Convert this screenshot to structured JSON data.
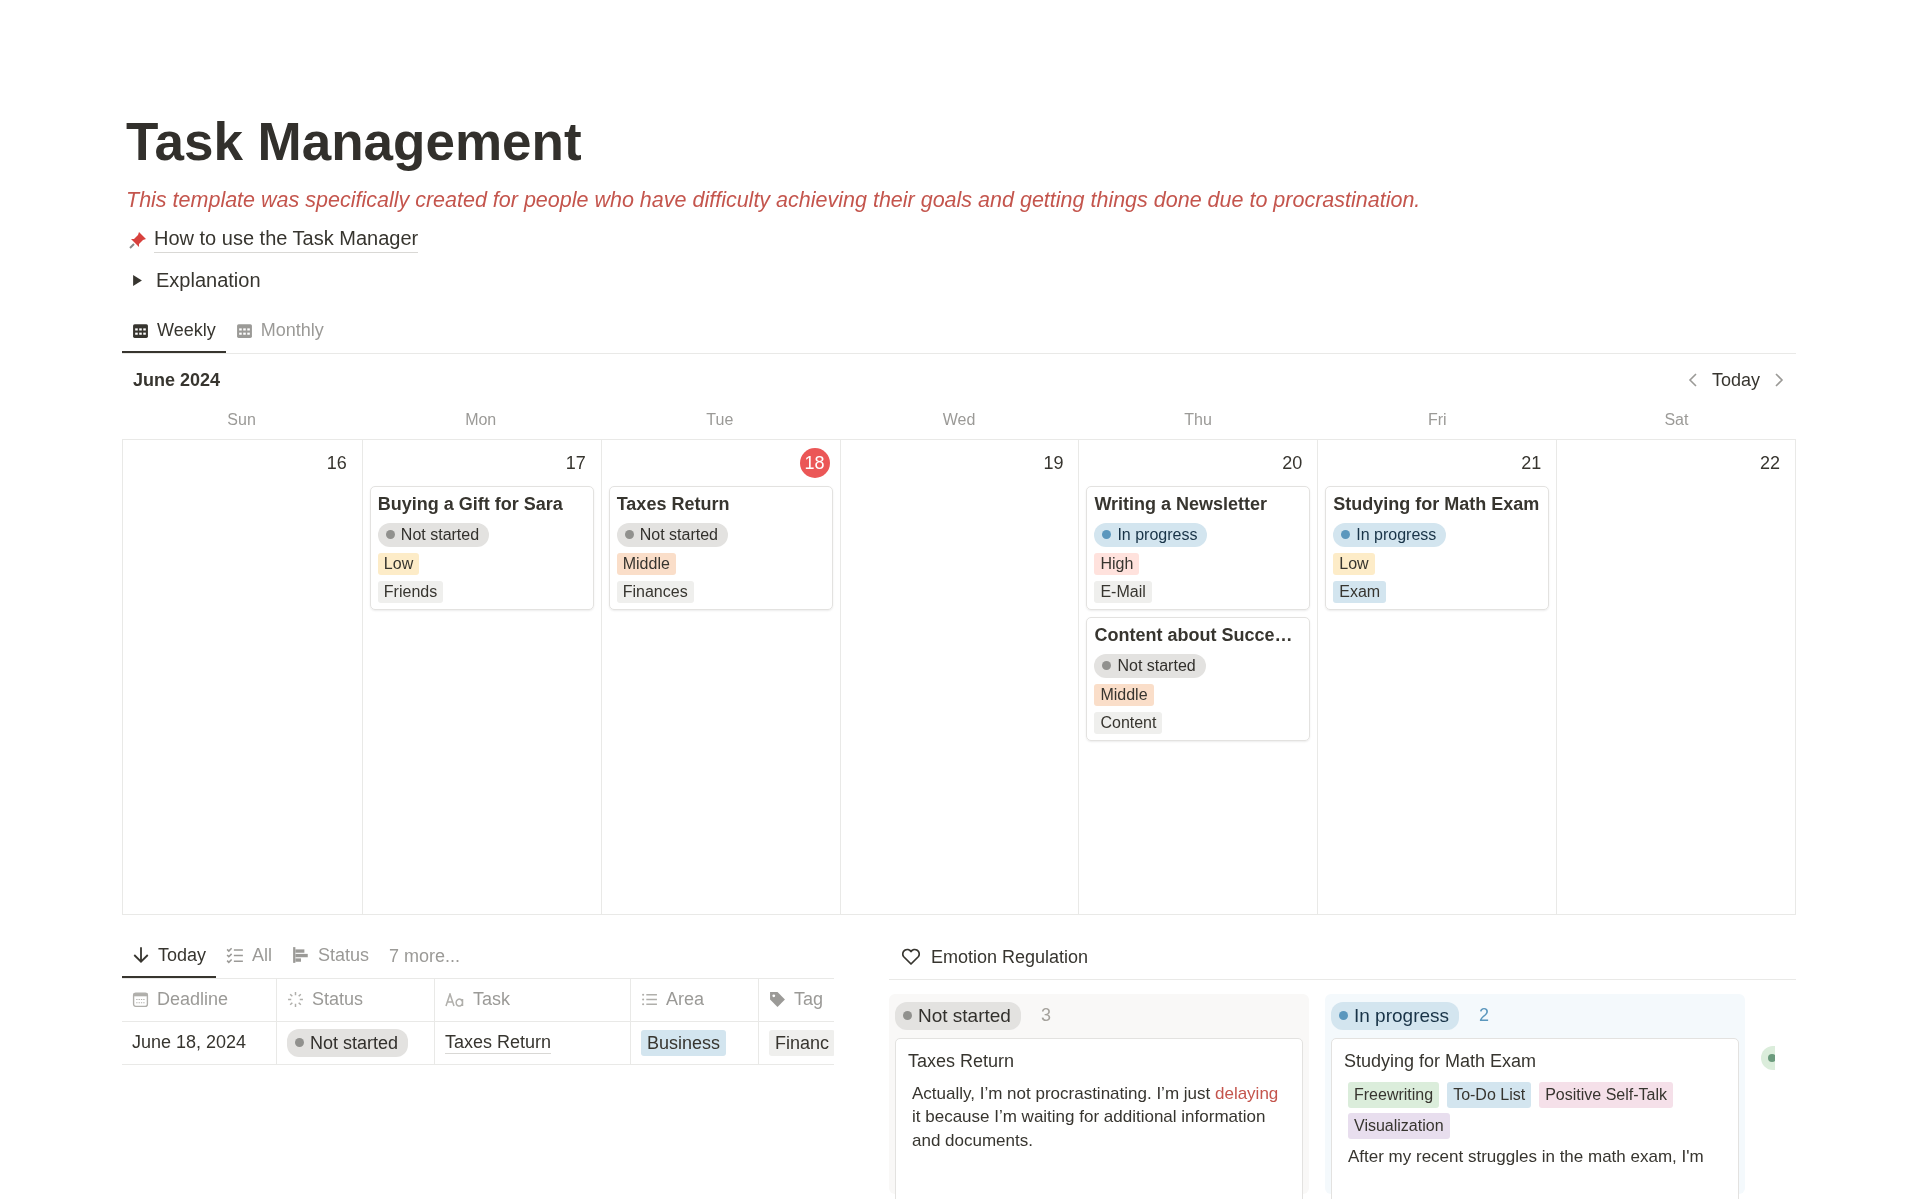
{
  "page": {
    "title": "Task Management",
    "description": "This template was specifically created for people who have difficulty achieving their goals and getting things done due to procrastination.",
    "link": {
      "label": "How to use the Task Manager"
    },
    "toggle": {
      "label": "Explanation",
      "expanded": false
    }
  },
  "calendar_tabs": [
    {
      "label": "Weekly",
      "selected": true
    },
    {
      "label": "Monthly",
      "selected": false
    }
  ],
  "calendar": {
    "month": "June 2024",
    "today_button": "Today",
    "weekdays": [
      "Sun",
      "Mon",
      "Tue",
      "Wed",
      "Thu",
      "Fri",
      "Sat"
    ],
    "days": [
      {
        "date": "16",
        "today": false
      },
      {
        "date": "17",
        "today": false,
        "events": [
          {
            "title": "Buying a Gift for Sara",
            "status": {
              "label": "Not started",
              "kind": "not_started"
            },
            "priority": {
              "label": "Low",
              "color": "#fdecc8"
            },
            "area": {
              "label": "Friends",
              "color": "#efefed"
            }
          }
        ]
      },
      {
        "date": "18",
        "today": true,
        "events": [
          {
            "title": "Taxes Return",
            "status": {
              "label": "Not started",
              "kind": "not_started"
            },
            "priority": {
              "label": "Middle",
              "color": "#fadec9"
            },
            "area": {
              "label": "Finances",
              "color": "#efefed"
            }
          }
        ]
      },
      {
        "date": "19",
        "today": false
      },
      {
        "date": "20",
        "today": false,
        "events": [
          {
            "title": "Writing a Newsletter",
            "status": {
              "label": "In progress",
              "kind": "in_progress"
            },
            "priority": {
              "label": "High",
              "color": "#ffe2dd"
            },
            "area": {
              "label": "E-Mail",
              "color": "#efefed"
            }
          },
          {
            "title": "Content about Succe…",
            "status": {
              "label": "Not started",
              "kind": "not_started"
            },
            "priority": {
              "label": "Middle",
              "color": "#fadec9"
            },
            "area": {
              "label": "Content",
              "color": "#efefed"
            }
          }
        ]
      },
      {
        "date": "21",
        "today": false,
        "events": [
          {
            "title": "Studying for Math Exam",
            "status": {
              "label": "In progress",
              "kind": "in_progress"
            },
            "priority": {
              "label": "Low",
              "color": "#fdecc8"
            },
            "area": {
              "label": "Exam",
              "color": "#d3e5ef"
            }
          }
        ]
      },
      {
        "date": "22",
        "today": false
      }
    ]
  },
  "table_view": {
    "tabs": [
      {
        "label": "Today",
        "kind": "sort",
        "selected": true
      },
      {
        "label": "All",
        "kind": "checklist",
        "selected": false
      },
      {
        "label": "Status",
        "kind": "board",
        "selected": false
      }
    ],
    "more_button": "7 more...",
    "columns": [
      {
        "label": "Deadline",
        "kind": "date"
      },
      {
        "label": "Status",
        "kind": "status"
      },
      {
        "label": "Task",
        "kind": "title"
      },
      {
        "label": "Area",
        "kind": "select"
      },
      {
        "label": "Tag",
        "kind": "tags"
      }
    ],
    "rows": [
      {
        "deadline": "June 18, 2024",
        "status": {
          "label": "Not started",
          "kind": "not_started"
        },
        "task": "Taxes Return",
        "area": {
          "label": "Business",
          "color": "#d3e5ef"
        },
        "tags": {
          "label": "Financ",
          "color": "#efefed"
        }
      }
    ]
  },
  "board": {
    "title": "Emotion Regulation",
    "groups": [
      {
        "label": "Not started",
        "kind": "not_started",
        "count": "3",
        "cards": [
          {
            "title": "Taxes Return",
            "body": [
              {
                "text": "Actually, I’m not procrastinating. I’m just ",
                "highlight": false
              },
              {
                "text": "delaying",
                "highlight": true
              },
              {
                "text": " it because I’m waiting for additional information and documents.",
                "highlight": false
              }
            ]
          }
        ]
      },
      {
        "label": "In progress",
        "kind": "in_progress",
        "count": "2",
        "cards": [
          {
            "title": "Studying for Math Exam",
            "tags": [
              {
                "label": "Freewriting",
                "color": "#dbeddb"
              },
              {
                "label": "To-Do List",
                "color": "#d3e5ef"
              },
              {
                "label": "Positive Self-Talk",
                "color": "#f5e0e9"
              },
              {
                "label": "Visualization",
                "color": "#e8deee"
              }
            ],
            "body": [
              {
                "text": "After my recent struggles in the math exam, I'm",
                "highlight": false
              }
            ]
          }
        ]
      }
    ]
  }
}
